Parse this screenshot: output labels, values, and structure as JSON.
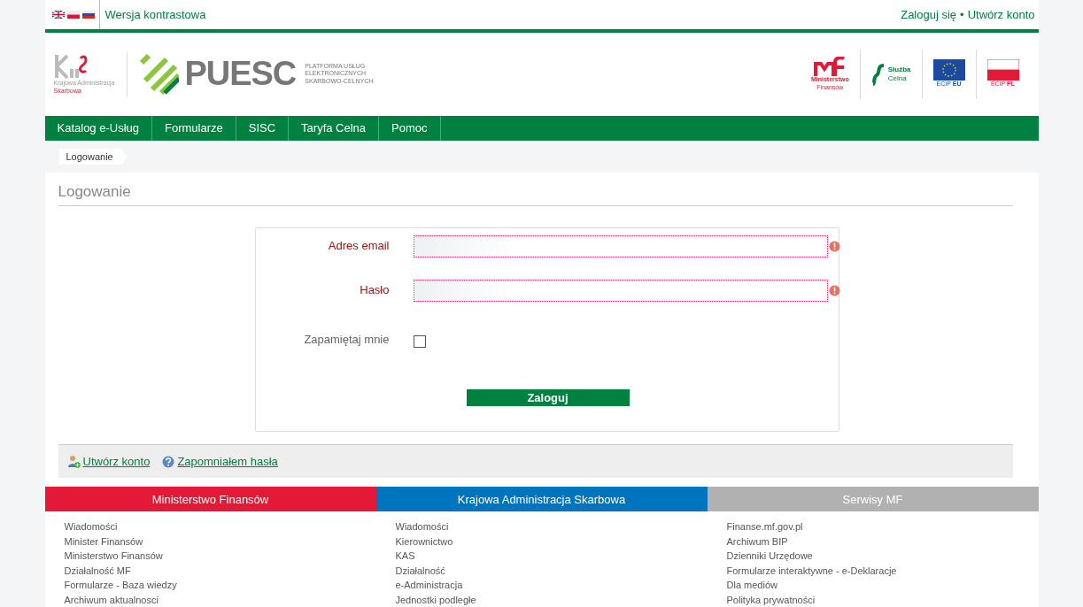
{
  "top_bar": {
    "contrast_link": "Wersja kontrastowa",
    "login_link": "Zaloguj się",
    "separator": "•",
    "register_link": "Utwórz konto"
  },
  "header": {
    "kas_logo": {
      "line1": "Krajowa Administracja",
      "line2": "Skarbowa"
    },
    "puesc_logo": {
      "name": "PUESC",
      "tagline": [
        "PLATFORMA USŁUG",
        "ELEKTRONICZNYCH",
        "SKARBOWO-CELNYCH"
      ]
    },
    "partners": [
      {
        "kind": "mf",
        "line1": "Ministerstwo",
        "line2": "Finansów"
      },
      {
        "kind": "customs",
        "line1": "Służba",
        "line2": "Celna"
      },
      {
        "kind": "eu",
        "line1": "ECIP",
        "line2": "EU"
      },
      {
        "kind": "pl",
        "line1": "ECIP",
        "line2": "PL"
      }
    ]
  },
  "nav": [
    {
      "label": "Katalog e-Usług",
      "selected": false
    },
    {
      "label": "Formularze",
      "selected": false
    },
    {
      "label": "SISC",
      "selected": false
    },
    {
      "label": "Taryfa Celna",
      "selected": false
    },
    {
      "label": "Pomoc",
      "selected": false
    }
  ],
  "breadcrumb": [
    "Logowanie"
  ],
  "page_title": "Logowanie",
  "form": {
    "fields": [
      {
        "label": "Adres email",
        "invalid": true
      },
      {
        "label": "Hasło",
        "invalid": true
      }
    ],
    "remember": {
      "label": "Zapamiętaj mnie",
      "checked": false
    },
    "submit": "Zaloguj"
  },
  "links": [
    {
      "kind": "user",
      "label": "Utwórz konto"
    },
    {
      "kind": "help",
      "label": "Zapomniałem hasła"
    }
  ],
  "footer": [
    {
      "title": "Ministerstwo Finansów",
      "color": "#e31937",
      "items": [
        "Wiadomości",
        "Minister Finansów",
        "Ministerstwo Finansów",
        "Działalność MF",
        "Formularze - Baza wiedzy",
        "Archiwum aktualnosci"
      ]
    },
    {
      "title": "Krajowa Administracja Skarbowa",
      "color": "#0075bf",
      "items": [
        "Wiadomości",
        "Kierownictwo",
        "KAS",
        "Działalność",
        "e-Administracja",
        "Jednostki podległe"
      ]
    },
    {
      "title": "Serwisy MF",
      "color": "#b1b1b1",
      "items": [
        "Finanse.mf.gov.pl",
        "Archiwum BIP",
        "Dzienniki Urzędowe",
        "Formularze interaktywne - e-Deklaracje",
        "Dla mediów",
        "Polityka prywatności"
      ]
    }
  ]
}
